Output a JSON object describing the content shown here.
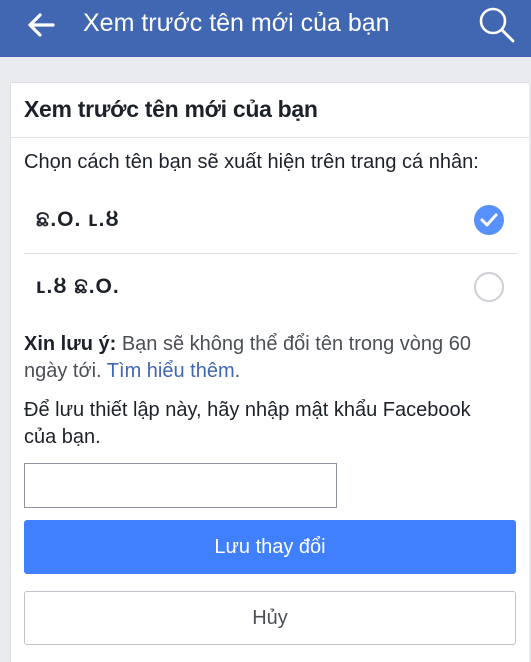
{
  "topbar": {
    "title": "Xem trước tên mới của bạn",
    "back_icon": "arrow-left-icon",
    "search_icon": "search-icon",
    "background": "#4267b2"
  },
  "card": {
    "title": "Xem trước tên mới của bạn",
    "prompt": "Chọn cách tên bạn sẽ xuất hiện trên trang cá nhân:",
    "options": [
      {
        "label": "ଛ.O. ʟ.ȣ",
        "selected": true
      },
      {
        "label": "ʟ.ȣ ଛ.O.",
        "selected": false
      }
    ],
    "notice": {
      "bold": "Xin lưu ý:",
      "text": " Bạn sẽ không thể đổi tên trong vòng 60 ngày tới. ",
      "link": "Tìm hiểu thêm",
      "after": "."
    },
    "password_prompt": "Để lưu thiết lập này, hãy nhập mật khẩu Facebook của bạn.",
    "password_value": "",
    "save_label": "Lưu thay đổi",
    "cancel_label": "Hủy",
    "accent": "#4080ff"
  }
}
